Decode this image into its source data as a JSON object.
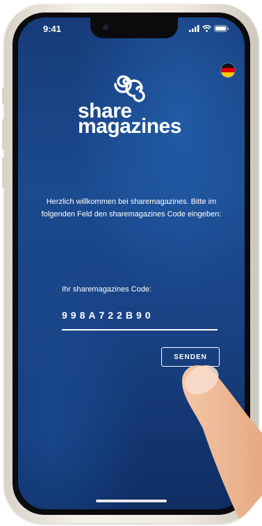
{
  "status_bar": {
    "time": "9:41"
  },
  "language": {
    "flag": "german-flag-icon"
  },
  "brand": {
    "line1": "share",
    "line2": "magazines"
  },
  "welcome": {
    "text": "Herzlich willkommen bei sharemagazines. Bitte im folgenden Feld den sharemagazines Code eingeben:"
  },
  "code_form": {
    "label": "Ihr sharemagazines Code:",
    "value": "998A722B90",
    "submit_label": "SENDEN"
  },
  "colors": {
    "background_top": "#173b78",
    "background_bottom": "#0f2d63",
    "text": "#ffffff",
    "skin": "#efbb98"
  }
}
